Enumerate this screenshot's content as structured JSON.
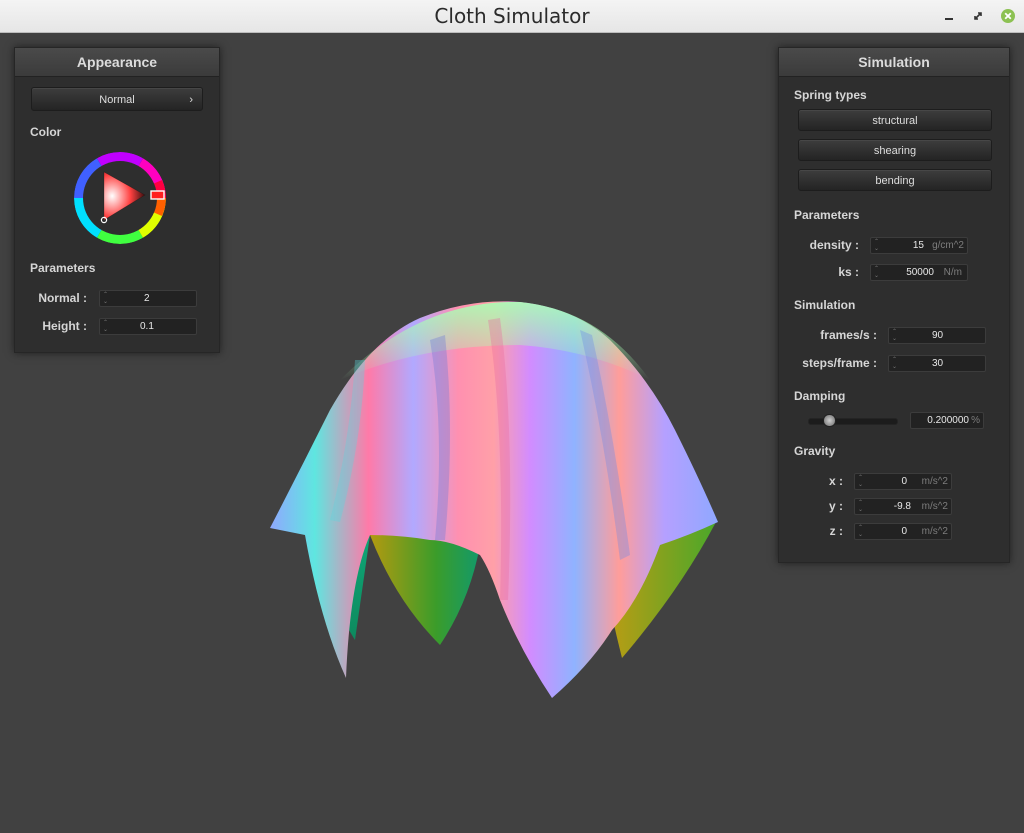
{
  "window": {
    "title": "Cloth Simulator"
  },
  "appearance": {
    "header": "Appearance",
    "shader_select": "Normal",
    "shader_chevron": "›",
    "color_label": "Color",
    "params_label": "Parameters",
    "normal_label": "Normal :",
    "normal_value": "2",
    "height_label": "Height :",
    "height_value": "0.1"
  },
  "simulation": {
    "header": "Simulation",
    "spring_types_label": "Spring types",
    "springs": [
      "structural",
      "shearing",
      "bending"
    ],
    "params_label": "Parameters",
    "density_label": "density :",
    "density_value": "15",
    "density_unit": "g/cm^2",
    "ks_label": "ks :",
    "ks_value": "50000",
    "ks_unit": "N/m",
    "sim_label": "Simulation",
    "fps_label": "frames/s :",
    "fps_value": "90",
    "steps_label": "steps/frame :",
    "steps_value": "30",
    "damping_label": "Damping",
    "damping_slider_level": 0.2,
    "damping_value": "0.200000",
    "damping_unit": "%",
    "gravity_label": "Gravity",
    "gx_label": "x :",
    "gx_value": "0",
    "gy_label": "y :",
    "gy_value": "-9.8",
    "gz_label": "z :",
    "gz_value": "0",
    "gravity_unit": "m/s^2"
  },
  "colors": {
    "background": "#414141",
    "panel": "#2e2e2e",
    "picked_color": "#ff0000"
  }
}
